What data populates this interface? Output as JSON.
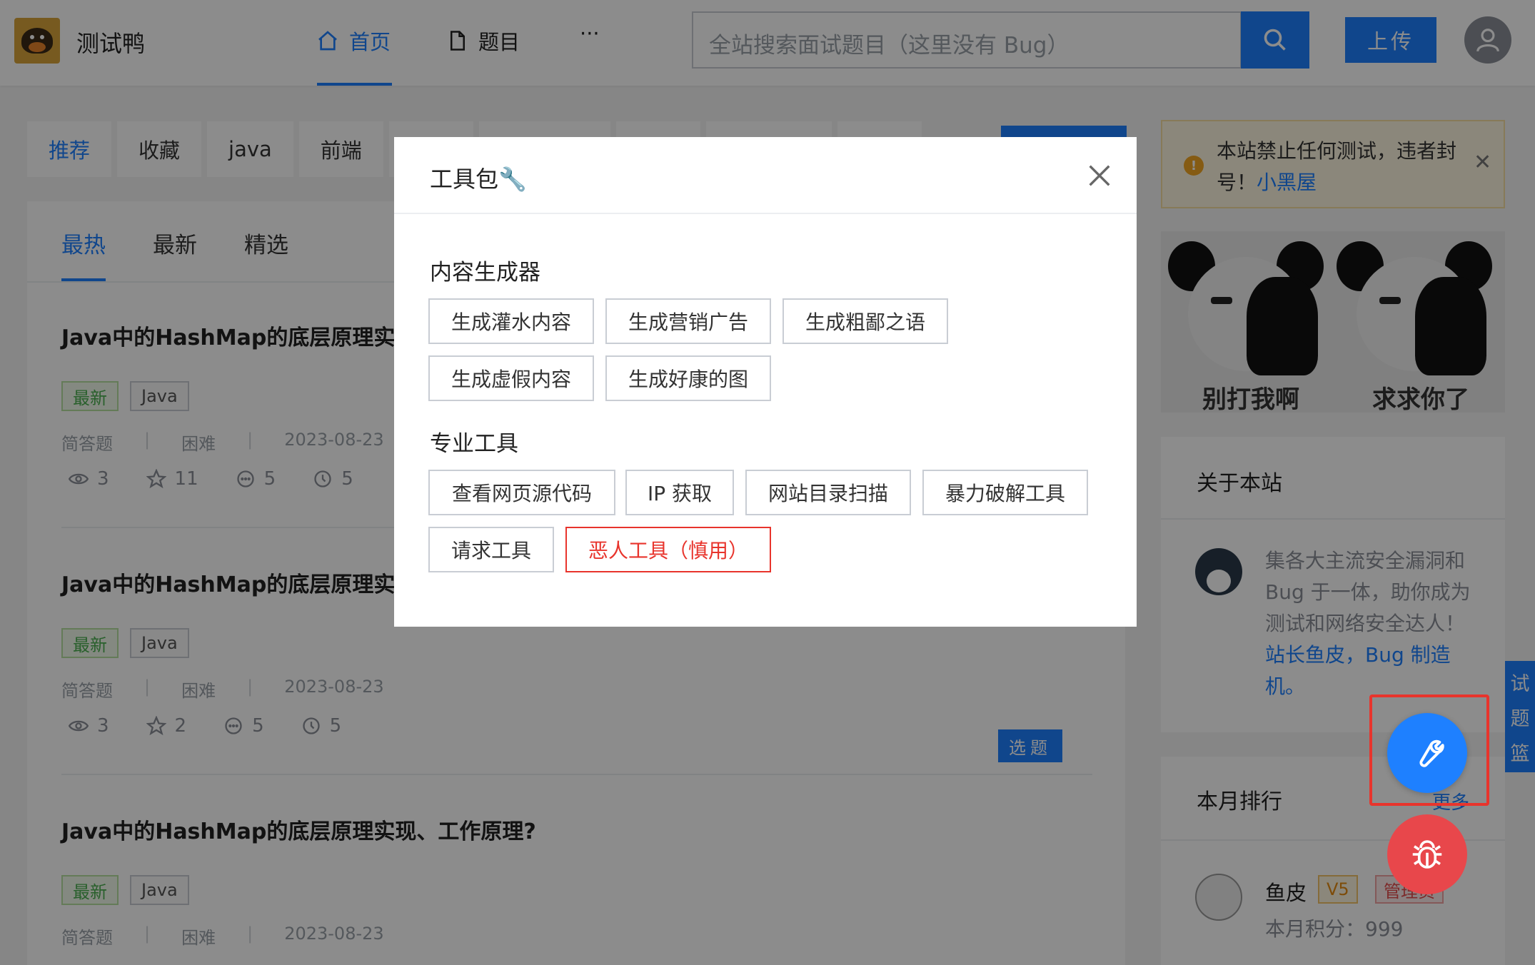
{
  "header": {
    "site_name": "测试鸭",
    "nav": [
      {
        "label": "首页",
        "icon": "home-icon"
      },
      {
        "label": "题目",
        "icon": "document-icon"
      },
      {
        "label": "···"
      }
    ],
    "search_placeholder": "全站搜索面试题目（这里没有 Bug）",
    "upload_label": "上传"
  },
  "tagbar": [
    "推荐",
    "收藏",
    "java",
    "前端"
  ],
  "sort_tabs": [
    "最热",
    "最新",
    "精选"
  ],
  "questions": [
    {
      "title": "Java中的HashMap的底层原理实",
      "tags": [
        "最新",
        "Java"
      ],
      "meta": [
        "简答题",
        "困难",
        "2023-08-23"
      ],
      "stats": [
        "3",
        "11",
        "5",
        "5"
      ]
    },
    {
      "title": "Java中的HashMap的底层原理实",
      "tags": [
        "最新",
        "Java"
      ],
      "meta": [
        "简答题",
        "困难",
        "2023-08-23"
      ],
      "stats": [
        "3",
        "2",
        "5",
        "5"
      ]
    },
    {
      "title": "Java中的HashMap的底层原理实现、工作原理?",
      "tags": [
        "最新",
        "Java"
      ],
      "meta": [
        "简答题",
        "困难",
        "2023-08-23"
      ]
    }
  ],
  "select_label": "选题",
  "notice": {
    "text": "本站禁止任何测试，违者封号！",
    "link": "小黑屋"
  },
  "meme": {
    "caption_left": "别打我啊",
    "caption_right": "求求你了"
  },
  "about": {
    "title": "关于本站",
    "desc": "集各大主流安全漏洞和 Bug 于一体，助你成为测试和网络安全达人！",
    "link": "站长鱼皮，Bug 制造机。"
  },
  "rank": {
    "title": "本月排行",
    "more": "更多",
    "user": {
      "name": "鱼皮",
      "level": "V5",
      "role": "管理员",
      "points": "本月积分：999"
    }
  },
  "basket": [
    "试",
    "题",
    "篮"
  ],
  "modal": {
    "title": "工具包🔧",
    "section1": {
      "title": "内容生成器",
      "buttons": [
        "生成灌水内容",
        "生成营销广告",
        "生成粗鄙之语",
        "生成虚假内容",
        "生成好康的图"
      ]
    },
    "section2": {
      "title": "专业工具",
      "buttons": [
        "查看网页源代码",
        "IP 获取",
        "网站目录扫描",
        "暴力破解工具",
        "请求工具",
        "恶人工具（慎用）"
      ]
    }
  },
  "colors": {
    "primary": "#1e80ff",
    "danger": "#e8342c",
    "warning": "#f2a623"
  }
}
